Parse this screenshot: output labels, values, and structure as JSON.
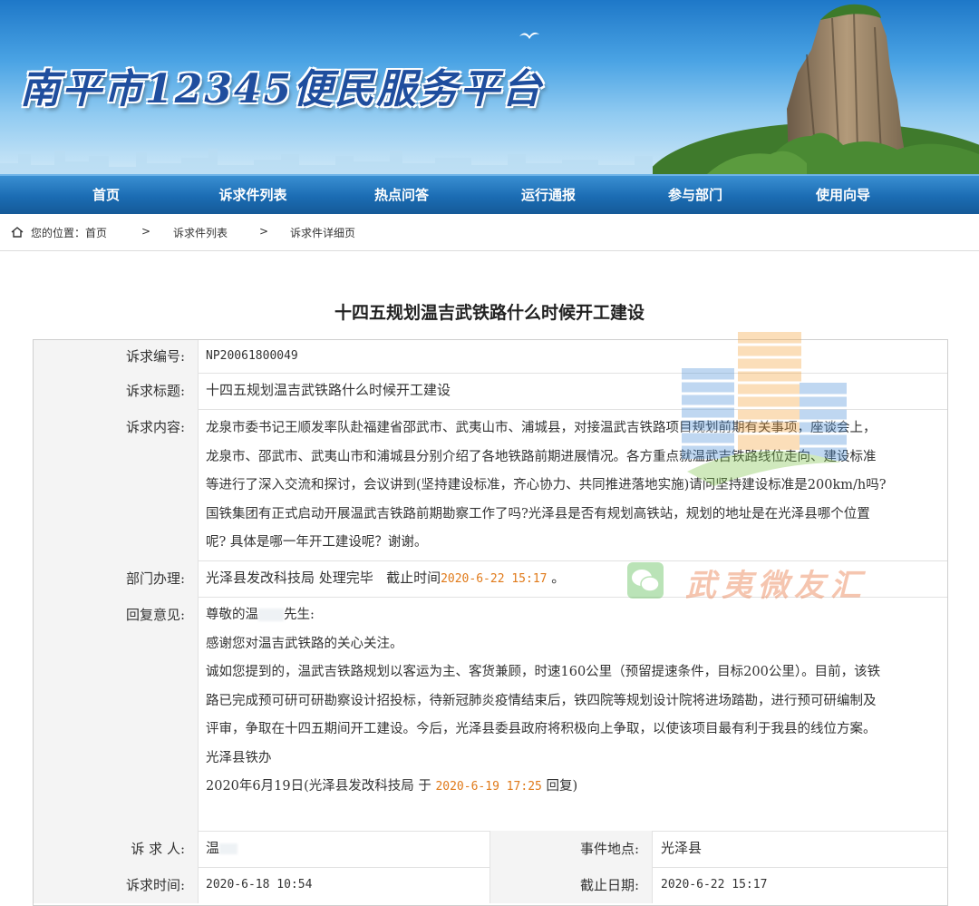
{
  "site": {
    "title": "南平市12345便民服务平台"
  },
  "nav": {
    "items": [
      "首页",
      "诉求件列表",
      "热点问答",
      "运行通报",
      "参与部门",
      "使用向导"
    ]
  },
  "breadcrumb": {
    "prefix": "您的位置：首页",
    "sep": ">",
    "level2": "诉求件列表",
    "level3": "诉求件详细页"
  },
  "page_title": "十四五规划温吉武铁路什么时候开工建设",
  "fields": {
    "id_label": "诉求编号:",
    "id_value": "NP20061800049",
    "subject_label": "诉求标题:",
    "subject_value": "十四五规划温吉武铁路什么时候开工建设",
    "content_label": "诉求内容:",
    "content_lines": [
      "龙泉市委书记王顺发率队赴福建省邵武市、武夷山市、浦城县，对接温武吉铁路项目规划前期有关事项，座谈会上，",
      "龙泉市、邵武市、武夷山市和浦城县分别介绍了各地铁路前期进展情况。各方重点就温武吉铁路线位走向、建设标准",
      "等进行了深入交流和探讨，会议讲到(坚持建设标准，齐心协力、共同推进落地实施)请问坚持建设标准是200km/h吗?",
      "国铁集团有正式启动开展温武吉铁路前期勘察工作了吗?光泽县是否有规划高铁站，规划的地址是在光泽县哪个位置",
      "呢? 具体是哪一年开工建设呢？谢谢。"
    ],
    "dept_label": "部门办理:",
    "dept_prefix": "光泽县发改科技局 处理完毕   截止时间",
    "dept_deadline": "2020-6-22 15:17",
    "dept_suffix": " 。",
    "reply_label": "回复意见:",
    "reply_lines": [
      "尊敬的温",
      "先生:",
      "感谢您对温吉武铁路的关心关注。",
      "诚如您提到的，温武吉铁路规划以客运为主、客货兼顾，时速160公里（预留提速条件，目标200公里）。目前，该铁",
      "路已完成预可研可研勘察设计招投标，待新冠肺炎疫情结束后，铁四院等规划设计院将进场踏勘，进行预可研编制及",
      "评审，争取在十四五期间开工建设。今后，光泽县委县政府将积极向上争取，以使该项目最有利于我县的线位方案。",
      "光泽县铁办"
    ],
    "reply_sign_prefix": "2020年6月19日(光泽县发改科技局 于 ",
    "reply_time": "2020-6-19 17:25",
    "reply_sign_suffix": " 回复)",
    "requester_label": "诉  求  人:",
    "requester_value": "温",
    "location_label": "事件地点:",
    "location_value": "光泽县",
    "time_label": "诉求时间:",
    "time_value": "2020-6-18 10:54",
    "deadline_label": "截止日期:",
    "deadline_value": "2020-6-22 15:17"
  },
  "watermark": {
    "text": "武夷微友汇"
  },
  "colors": {
    "nav": "#1b6cb3",
    "accent_orange": "#e07a1a",
    "title_blue": "#1f4e9e"
  }
}
